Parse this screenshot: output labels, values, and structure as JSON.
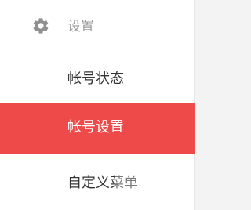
{
  "colors": {
    "active_background": "#ef4a4a",
    "active_text": "#ffffff",
    "default_text": "#333333",
    "section_text": "#9a9a9a",
    "page_background": "#f3f3f3"
  },
  "section": {
    "icon": "gear-icon",
    "label": "设置"
  },
  "menu": {
    "items": [
      {
        "label": "帐号状态",
        "active": false
      },
      {
        "label": "帐号设置",
        "active": true
      },
      {
        "label": "自定义菜单",
        "active": false
      }
    ]
  }
}
